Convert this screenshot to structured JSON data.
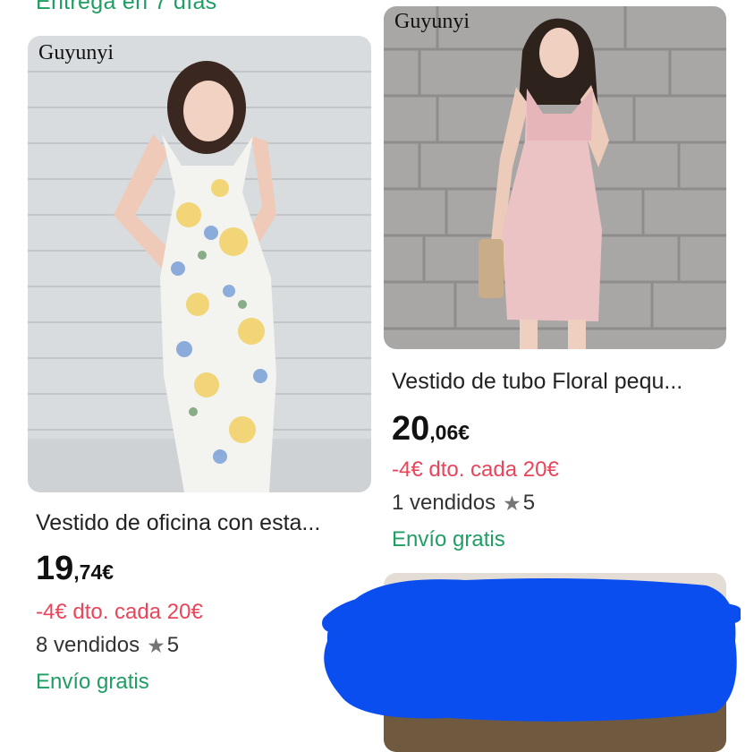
{
  "top_cut_text": "Entrega en 7 días",
  "products": [
    {
      "brand": "Guyunyi",
      "title": "Vestido de oficina con esta...",
      "price_int": "19",
      "price_dec": ",74€",
      "discount": "-4€ dto. cada 20€",
      "sold": "8 vendidos",
      "rating": "5",
      "shipping": "Envío gratis"
    },
    {
      "brand": "Guyunyi",
      "title": "Vestido de tubo Floral pequ...",
      "price_int": "20",
      "price_dec": ",06€",
      "discount": "-4€ dto. cada 20€",
      "sold": "1 vendidos",
      "rating": "5",
      "shipping": "Envío gratis"
    }
  ],
  "colors": {
    "discount": "#e8455b",
    "shipping": "#1f9e63",
    "redaction": "#0a4ef0"
  }
}
